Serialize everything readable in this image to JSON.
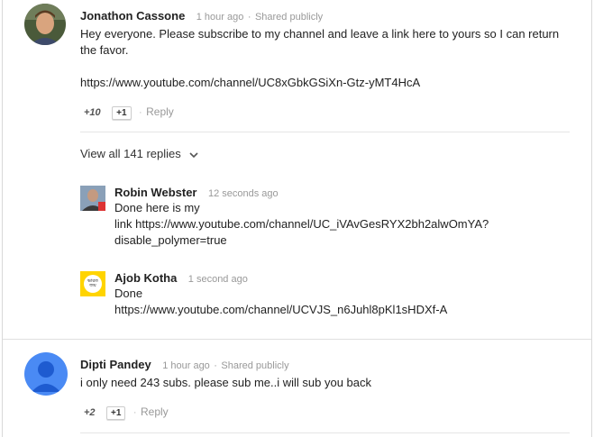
{
  "comments": [
    {
      "author": "Jonathon Cassone",
      "time": "1 hour ago",
      "visibility": "Shared publicly",
      "text_line1": "Hey everyone. Please subscribe to my channel and leave a link here to yours so I can return",
      "text_line2": "the favor.",
      "link": "https://www.youtube.com/channel/UC8xGbkGSiXn-Gtz-yMT4HcA",
      "plus_count": "+10",
      "plus_button": "+1",
      "reply_label": "Reply"
    },
    {
      "author": "Dipti Pandey",
      "time": "1 hour ago",
      "visibility": "Shared publicly",
      "text": "i only need 243 subs. please sub me..i will sub you back",
      "plus_count": "+2",
      "plus_button": "+1",
      "reply_label": "Reply"
    }
  ],
  "view_replies": "View all 141 replies",
  "replies": [
    {
      "author": "Robin Webster",
      "time": "12 seconds ago",
      "line1": "Done here is my",
      "line2": "link https://www.youtube.com/channel/UC_iVAvGesRYX2bh2alwOmYA?",
      "line3": "disable_polymer=true"
    },
    {
      "author": "Ajob Kotha",
      "time": "1 second ago",
      "line1": "Done",
      "line2": "https://www.youtube.com/channel/UCVJS_n6Juhl8pKl1sHDXf-A",
      "avatar_text": "ভারত জয়"
    }
  ],
  "separator": "·",
  "icons": [
    "chevron-down-icon",
    "default-avatar-icon"
  ],
  "colors": {
    "meta": "#999999",
    "avatar_blue": "#4a8af4"
  }
}
